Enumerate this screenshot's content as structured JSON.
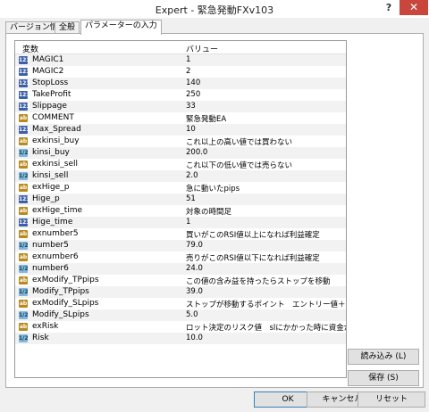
{
  "window": {
    "title": "Expert - 緊急発動FXv103",
    "help": "?",
    "close": "✕"
  },
  "tabs": [
    {
      "label": "バージョン情報"
    },
    {
      "label": "全般"
    },
    {
      "label": "パラメーターの入力"
    }
  ],
  "grid": {
    "col_name": "変数",
    "col_value": "バリュー",
    "rows": [
      {
        "type": "123",
        "name": "MAGIC1",
        "value": "1"
      },
      {
        "type": "123",
        "name": "MAGIC2",
        "value": "2"
      },
      {
        "type": "123",
        "name": "StopLoss",
        "value": "140"
      },
      {
        "type": "123",
        "name": "TakeProfit",
        "value": "250"
      },
      {
        "type": "123",
        "name": "Slippage",
        "value": "33"
      },
      {
        "type": "ab",
        "name": "COMMENT",
        "value": "緊急発動EA"
      },
      {
        "type": "123",
        "name": "Max_Spread",
        "value": "10"
      },
      {
        "type": "ab",
        "name": "exkinsi_buy",
        "value": "これ以上の高い値では買わない"
      },
      {
        "type": "1/2",
        "name": "kinsi_buy",
        "value": "200.0"
      },
      {
        "type": "ab",
        "name": "exkinsi_sell",
        "value": "これ以下の低い値では売らない"
      },
      {
        "type": "1/2",
        "name": "kinsi_sell",
        "value": "2.0"
      },
      {
        "type": "ab",
        "name": "exHige_p",
        "value": "急に動いたpips"
      },
      {
        "type": "123",
        "name": "Hige_p",
        "value": "51"
      },
      {
        "type": "ab",
        "name": "exHige_time",
        "value": "対象の時間足"
      },
      {
        "type": "123",
        "name": "Hige_time",
        "value": "1"
      },
      {
        "type": "ab",
        "name": "exnumber5",
        "value": "買いがこのRSI値以上になれば利益確定"
      },
      {
        "type": "1/2",
        "name": "number5",
        "value": "79.0"
      },
      {
        "type": "ab",
        "name": "exnumber6",
        "value": "売りがこのRSI値以下になれば利益確定"
      },
      {
        "type": "1/2",
        "name": "number6",
        "value": "24.0"
      },
      {
        "type": "ab",
        "name": "exModify_TPpips",
        "value": "この値の含み益を持ったらストップを移動"
      },
      {
        "type": "1/2",
        "name": "Modify_TPpips",
        "value": "39.0"
      },
      {
        "type": "ab",
        "name": "exModify_SLpips",
        "value": "ストップが移動するポイント　エントリー値＋(n)pips"
      },
      {
        "type": "1/2",
        "name": "Modify_SLpips",
        "value": "5.0"
      },
      {
        "type": "ab",
        "name": "exRisk",
        "value": "ロット決定のリスク値　slにかかった時に資金が減る%"
      },
      {
        "type": "1/2",
        "name": "Risk",
        "value": "10.0"
      }
    ]
  },
  "side_buttons": {
    "load": "読み込み (L)",
    "save": "保存 (S)"
  },
  "bottom_buttons": {
    "ok": "OK",
    "cancel": "キャンセル",
    "reset": "リセット"
  }
}
